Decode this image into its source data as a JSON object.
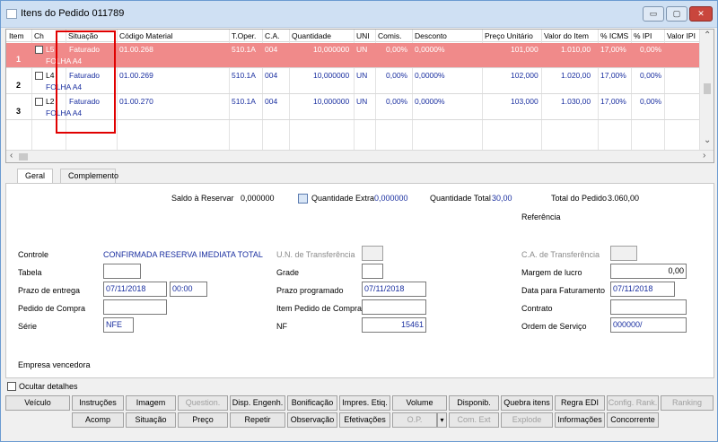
{
  "window": {
    "title": "Itens do Pedido 011789",
    "btn_min": "▭",
    "btn_max": "▢",
    "btn_close": "✕"
  },
  "grid": {
    "headers": [
      "Item",
      "Ch",
      "Situação",
      "Código Material",
      "T.Oper.",
      "C.A.",
      "Quantidade",
      "UNI",
      "Comis.",
      "Desconto",
      "Preço Unitário",
      "Valor do Item",
      "% ICMS",
      "% IPI",
      "Valor IPI"
    ],
    "rows": [
      {
        "num": "1",
        "ch": "L5",
        "situacao": "Faturado",
        "material": "01.00.268",
        "toper": "510.1A",
        "ca": "004",
        "qtd": "10,000000",
        "uni": "UN",
        "comis": "0,00%",
        "desconto": "0,0000%",
        "preco": "101,000",
        "valor": "1.010,00",
        "icms": "17,00%",
        "ipi": "0,00%",
        "desc2": "FOLHA A4"
      },
      {
        "num": "2",
        "ch": "L4",
        "situacao": "Faturado",
        "material": "01.00.269",
        "toper": "510.1A",
        "ca": "004",
        "qtd": "10,000000",
        "uni": "UN",
        "comis": "0,00%",
        "desconto": "0,0000%",
        "preco": "102,000",
        "valor": "1.020,00",
        "icms": "17,00%",
        "ipi": "0,00%",
        "desc2": "FOLHA A4"
      },
      {
        "num": "3",
        "ch": "L2",
        "situacao": "Faturado",
        "material": "01.00.270",
        "toper": "510.1A",
        "ca": "004",
        "qtd": "10,000000",
        "uni": "UN",
        "comis": "0,00%",
        "desconto": "0,0000%",
        "preco": "103,000",
        "valor": "1.030,00",
        "icms": "17,00%",
        "ipi": "0,00%",
        "desc2": "FOLHA A4"
      }
    ],
    "selected_color": "#f08a8a",
    "highlight_color": "#e00000"
  },
  "tabs": [
    "Geral",
    "Complemento"
  ],
  "summary": {
    "saldo_label": "Saldo à Reservar",
    "saldo_value": "0,000000",
    "qtd_extra_label": "Quantidade Extra",
    "qtd_extra_value": "0,000000",
    "qtd_total_label": "Quantidade Total",
    "qtd_total_value": "30,00",
    "total_pedido_label": "Total do Pedido",
    "total_pedido_value": "3.060,00",
    "referencia_label": "Referência"
  },
  "form": {
    "controle_label": "Controle",
    "controle_value": "CONFIRMADA RESERVA IMEDIATA TOTAL",
    "un_transf_label": "U.N. de Transferência",
    "ca_transf_label": "C.A. de Transferência",
    "tabela_label": "Tabela",
    "grade_label": "Grade",
    "margem_label": "Margem de lucro",
    "margem_value": "0,00",
    "prazo_entrega_label": "Prazo de entrega",
    "prazo_entrega_date": "07/11/2018",
    "prazo_entrega_time": "00:00",
    "prazo_prog_label": "Prazo programado",
    "prazo_prog_value": "07/11/2018",
    "data_fat_label": "Data para Faturamento",
    "data_fat_value": "07/11/2018",
    "pedido_compra_label": "Pedido de Compra",
    "item_pedido_label": "Item Pedido de Compra",
    "contrato_label": "Contrato",
    "serie_label": "Série",
    "serie_value": "NFE",
    "nf_label": "NF",
    "nf_value": "15461",
    "ordem_label": "Ordem de Serviço",
    "ordem_value": "000000/",
    "empresa_label": "Empresa vencedora"
  },
  "ocultar_label": "Ocultar detalhes",
  "buttons_row1": [
    "Veículo",
    "Instruções",
    "Imagem",
    "Question.",
    "Disp. Engenh.",
    "Bonificação",
    "Impres. Etiq.",
    "Volume",
    "Disponib.",
    "Quebra itens",
    "Regra EDI",
    "Config. Rank.",
    "Ranking"
  ],
  "buttons_row2": [
    "Acomp",
    "Situação",
    "Preço",
    "Repetir",
    "Observação",
    "Efetivações",
    "O.P.",
    "Com. Ext",
    "Explode",
    "Informações",
    "Concorrente"
  ]
}
